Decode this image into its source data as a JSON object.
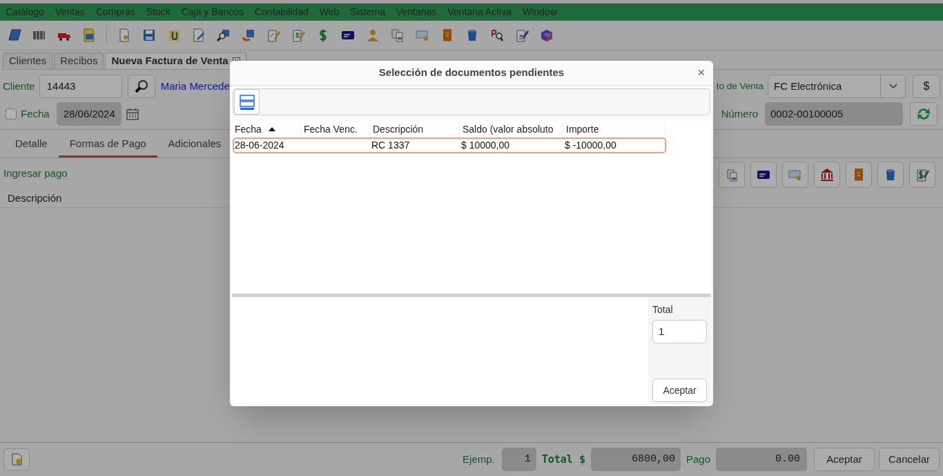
{
  "menu": [
    "Catálogo",
    "Ventas",
    "Compras",
    "Stock",
    "Caja y Bancos",
    "Contabilidad",
    "Web",
    "Sistema",
    "Ventanas",
    "Ventana Activa",
    "Window"
  ],
  "tabs": [
    {
      "label": "Clientes",
      "selected": false,
      "closable": false
    },
    {
      "label": "Recibos",
      "selected": false,
      "closable": false
    },
    {
      "label": "Nueva Factura de Venta",
      "selected": true,
      "closable": true
    }
  ],
  "form": {
    "cliente_label": "Cliente",
    "cliente_code": "14443",
    "cliente_name": "Maria Mercede",
    "fecha_label": "Fecha",
    "fecha_checked": false,
    "fecha_value": "28/06/2024",
    "punto_label": "to de Venta",
    "punto_value": "FC Electrónica",
    "currency_button": "$",
    "numero_label": "Número",
    "numero_value": "0002-00100005"
  },
  "subtabs": [
    {
      "label": "Detalle",
      "selected": false
    },
    {
      "label": "Formas de Pago",
      "selected": true
    },
    {
      "label": "Adicionales",
      "selected": false
    }
  ],
  "ingresar_pago": "Ingresar pago",
  "payments_table": {
    "columns": [
      "Descripción"
    ]
  },
  "footer": {
    "ejemplares_label": "Ejemp.",
    "ejemplares": "1",
    "total_label": "Total $",
    "total": "6800,00",
    "pago_label": "Pago",
    "pago": "0.00",
    "buttons": [
      "Aceptar",
      "Cancelar"
    ]
  },
  "dialog": {
    "title": "Selección de documentos pendientes",
    "close": "×",
    "columns": [
      {
        "label": "Fecha",
        "sorted": true
      },
      {
        "label": "Fecha Venc.",
        "sorted": false
      },
      {
        "label": "Descripción",
        "sorted": false
      },
      {
        "label": "Saldo (valor absoluto",
        "sorted": false
      },
      {
        "label": "Importe",
        "sorted": false
      }
    ],
    "rows": [
      {
        "cells": [
          "28-06-2024",
          "",
          "RC 1337",
          "$ 10000,00",
          "$ -10000,00"
        ],
        "selected": true
      }
    ],
    "total_label": "Total",
    "total_value": "1",
    "button": "Aceptar"
  }
}
